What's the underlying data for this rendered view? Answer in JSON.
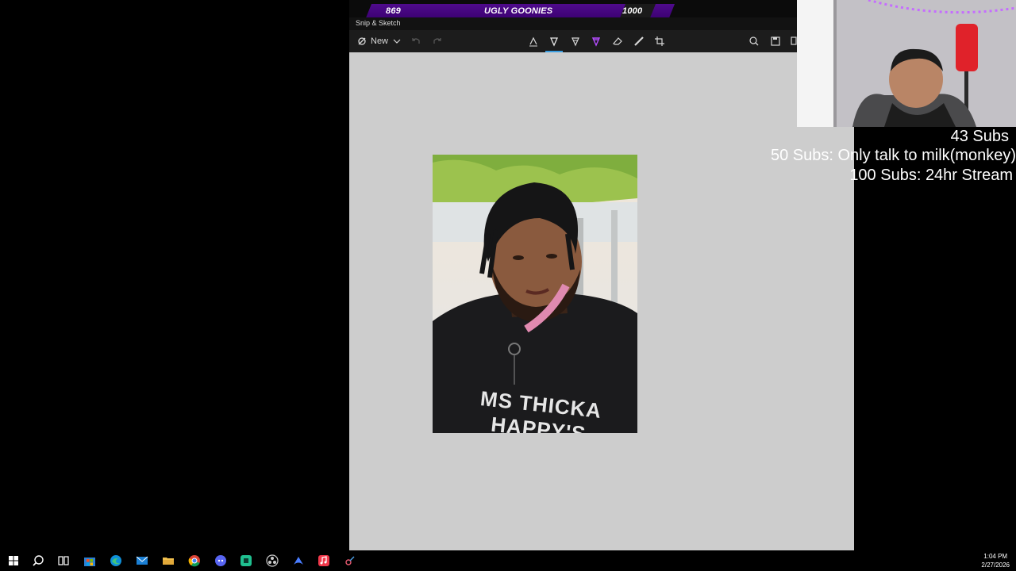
{
  "goal": {
    "current": "869",
    "title": "UGLY GOONIES",
    "target": "1000",
    "progress": 0.869
  },
  "window": {
    "title": "Snip & Sketch",
    "new_label": "New"
  },
  "overlay": {
    "subs": "43 Subs",
    "goal1": "50 Subs: Only talk to milk(monkey)",
    "goal2": "100 Subs: 24hr Stream"
  },
  "photo": {
    "shirt_text": "MS THICKA HAPPY'S"
  },
  "clock": {
    "time": "1:04 PM",
    "date": "2/27/2026"
  },
  "taskbar_icons": [
    "windows-start-icon",
    "search-icon",
    "task-view-icon",
    "microsoft-store-icon",
    "edge-icon",
    "mail-icon",
    "file-explorer-icon",
    "chrome-icon",
    "discord-icon",
    "app-icon",
    "obs-icon",
    "vpn-icon",
    "music-icon",
    "snip-icon"
  ],
  "colors": {
    "goal_purple": "#4f0b8c",
    "canvas": "#cdcdcd",
    "ink_accent": "#3a9de0",
    "cam_led": "#b44cff"
  }
}
